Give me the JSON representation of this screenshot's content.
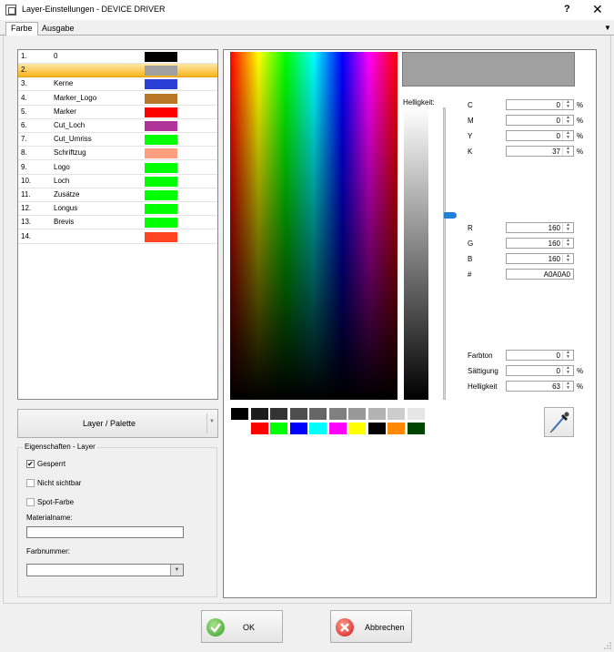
{
  "window": {
    "title": "Layer-Einstellungen - DEVICE DRIVER",
    "help": "?",
    "close": "✕"
  },
  "tabs": [
    "Farbe",
    "Ausgabe"
  ],
  "layers": [
    {
      "num": "1.",
      "name": "0",
      "color": "#000000"
    },
    {
      "num": "2.",
      "name": "",
      "color": "#a0a0a0"
    },
    {
      "num": "3.",
      "name": "Kerne",
      "color": "#2a3fd6"
    },
    {
      "num": "4.",
      "name": "Marker_Logo",
      "color": "#b87726"
    },
    {
      "num": "5.",
      "name": "Marker",
      "color": "#ff0000"
    },
    {
      "num": "6.",
      "name": "Cut_Loch",
      "color": "#b0349a"
    },
    {
      "num": "7.",
      "name": "Cut_Umriss",
      "color": "#00ff00"
    },
    {
      "num": "8.",
      "name": "Schriftzug",
      "color": "#ff9f80"
    },
    {
      "num": "9.",
      "name": "Logo",
      "color": "#00ff00"
    },
    {
      "num": "10.",
      "name": "Loch",
      "color": "#00ff00"
    },
    {
      "num": "11.",
      "name": "Zusätze",
      "color": "#00ff00"
    },
    {
      "num": "12.",
      "name": "Longus",
      "color": "#00ff00"
    },
    {
      "num": "13.",
      "name": "Brevis",
      "color": "#00ff00"
    },
    {
      "num": "14.",
      "name": "",
      "color": "#ff4422"
    }
  ],
  "selected_layer_index": 1,
  "palette_button": "Layer / Palette",
  "properties": {
    "legend": "Eigenschaften - Layer",
    "gesperrt": {
      "label": "Gesperrt",
      "checked": true
    },
    "nicht_sichtbar": {
      "label": "Nicht sichtbar",
      "checked": false
    },
    "spot_farbe": {
      "label": "Spot-Farbe",
      "checked": false
    },
    "materialname_label": "Materialname:",
    "materialname_value": "",
    "farbnummer_label": "Farbnummer:",
    "farbnummer_value": ""
  },
  "color": {
    "preview": "#a0a0a0",
    "helligkeit_label": "Helligkeit:",
    "cmyk": [
      {
        "label": "C",
        "value": "0",
        "unit": "%"
      },
      {
        "label": "M",
        "value": "0",
        "unit": "%"
      },
      {
        "label": "Y",
        "value": "0",
        "unit": "%"
      },
      {
        "label": "K",
        "value": "37",
        "unit": "%"
      }
    ],
    "rgb": [
      {
        "label": "R",
        "value": "160"
      },
      {
        "label": "G",
        "value": "160"
      },
      {
        "label": "B",
        "value": "160"
      }
    ],
    "hex": {
      "label": "#",
      "value": "A0A0A0"
    },
    "hsl": [
      {
        "label": "Farbton",
        "value": "0",
        "unit": ""
      },
      {
        "label": "Sättigung",
        "value": "0",
        "unit": "%"
      },
      {
        "label": "Helligkeit",
        "value": "63",
        "unit": "%"
      }
    ]
  },
  "palette_row1": [
    "#000000",
    "#1c1c1c",
    "#333333",
    "#4d4d4d",
    "#666666",
    "#808080",
    "#999999",
    "#b3b3b3",
    "#cccccc",
    "#e6e6e6"
  ],
  "palette_row2": [
    "#ffffff",
    "#ff0000",
    "#00ff00",
    "#0000ff",
    "#00ffff",
    "#ff00ff",
    "#ffff00",
    "#000000",
    "#ff8800",
    "#004400"
  ],
  "buttons": {
    "ok": "OK",
    "cancel": "Abbrechen"
  }
}
